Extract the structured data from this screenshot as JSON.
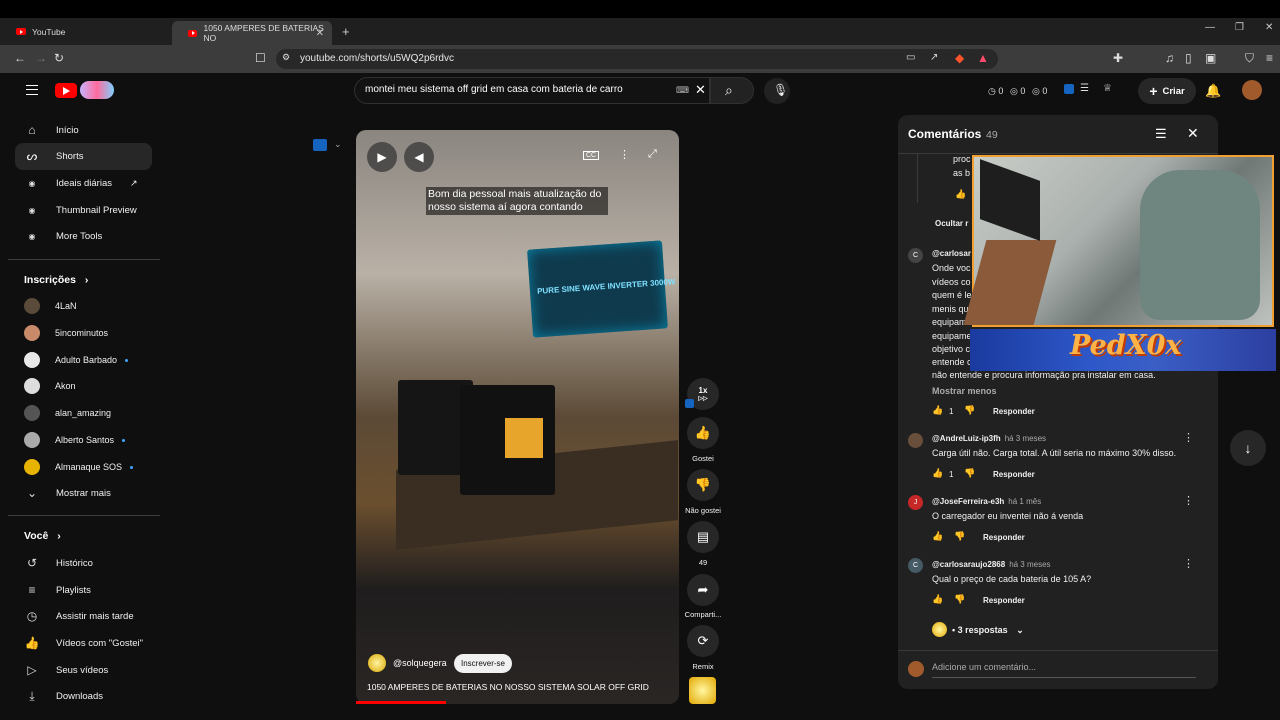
{
  "browser": {
    "tabs": [
      {
        "label": "YouTube"
      },
      {
        "label": "1050 AMPERES DE BATERIAS NO"
      }
    ],
    "url": "youtube.com/shorts/u5WQ2p6rdvc"
  },
  "header": {
    "search_value": "montei meu sistema off grid em casa com bateria de carro",
    "counters": [
      "0",
      "0",
      "0"
    ],
    "create_label": "Criar"
  },
  "sidebar": {
    "items": [
      {
        "label": "Início",
        "icon": "home-icon"
      },
      {
        "label": "Shorts",
        "icon": "shorts-icon"
      },
      {
        "label": "Ideais diárias",
        "icon": "extension-icon"
      },
      {
        "label": "Thumbnail Preview",
        "icon": "extension-icon"
      },
      {
        "label": "More Tools",
        "icon": "extension-icon"
      }
    ],
    "subscriptions_title": "Inscrições",
    "channels": [
      {
        "name": "4LaN",
        "dot": false
      },
      {
        "name": "5incominutos",
        "dot": false
      },
      {
        "name": "Adulto Barbado",
        "dot": true
      },
      {
        "name": "Akon",
        "dot": false
      },
      {
        "name": "alan_amazing",
        "dot": false
      },
      {
        "name": "Alberto Santos",
        "dot": true
      },
      {
        "name": "Almanaque SOS",
        "dot": true
      }
    ],
    "show_more": "Mostrar mais",
    "you_title": "Você",
    "you_items": [
      {
        "label": "Histórico"
      },
      {
        "label": "Playlists"
      },
      {
        "label": "Assistir mais tarde"
      },
      {
        "label": "Vídeos com \"Gostei\""
      },
      {
        "label": "Seus vídeos"
      },
      {
        "label": "Downloads"
      }
    ]
  },
  "video": {
    "caption": "Bom dia pessoal mais atualização do nosso sistema aí agora contando",
    "inverter_text": "PURE SINE WAVE INVERTER 3000W",
    "channel": "@solquegera",
    "subscribe_label": "Inscrever-se",
    "title": "1050 AMPERES DE BATERIAS NO NOSSO SISTEMA SOLAR OFF GRID",
    "progress": 0.28
  },
  "actions": {
    "speed": "1x",
    "like": "Gostei",
    "dislike": "Não gostei",
    "comments": "49",
    "share": "Comparti...",
    "remix": "Remix"
  },
  "comments": {
    "title": "Comentários",
    "count": "49",
    "partial_top": [
      "proc",
      "as b"
    ],
    "hide_label": "Ocultar r",
    "list": [
      {
        "author": "@carlosar",
        "time": "",
        "initial": "C",
        "lines": [
          "Onde voc",
          "vídeos co",
          "quem é le",
          "menis qu",
          "equipame",
          "equipame",
          "objetivo c",
          "entende c",
          "não entende e procura informação pra instalar em casa."
        ],
        "likes": "1"
      },
      {
        "author": "@AndreLuiz-ip3fh",
        "time": "há 3 meses",
        "initial": "",
        "lines": [
          "Carga útil não. Carga total. A útil seria no máximo 30% disso."
        ],
        "likes": "1"
      },
      {
        "author": "@JoseFerreira-e3h",
        "time": "há 1 mês",
        "initial": "J",
        "lines": [
          "O carregador eu inventei não á venda"
        ],
        "likes": ""
      },
      {
        "author": "@carlosaraujo2868",
        "time": "há 3 meses",
        "initial": "C",
        "lines": [
          "Qual o preço de cada bateria de 105 A?"
        ],
        "likes": ""
      }
    ],
    "show_less": "Mostrar menos",
    "reply_label": "Responder",
    "replies_label": "• 3 respostas",
    "add_placeholder": "Adicione um comentário..."
  },
  "overlay": {
    "banner_text": "PedX0x"
  },
  "colors": {
    "brand_red": "#ff0000",
    "panel_bg": "#212121",
    "page_bg": "#0f0f0f",
    "overlay_border": "#f0a030"
  }
}
